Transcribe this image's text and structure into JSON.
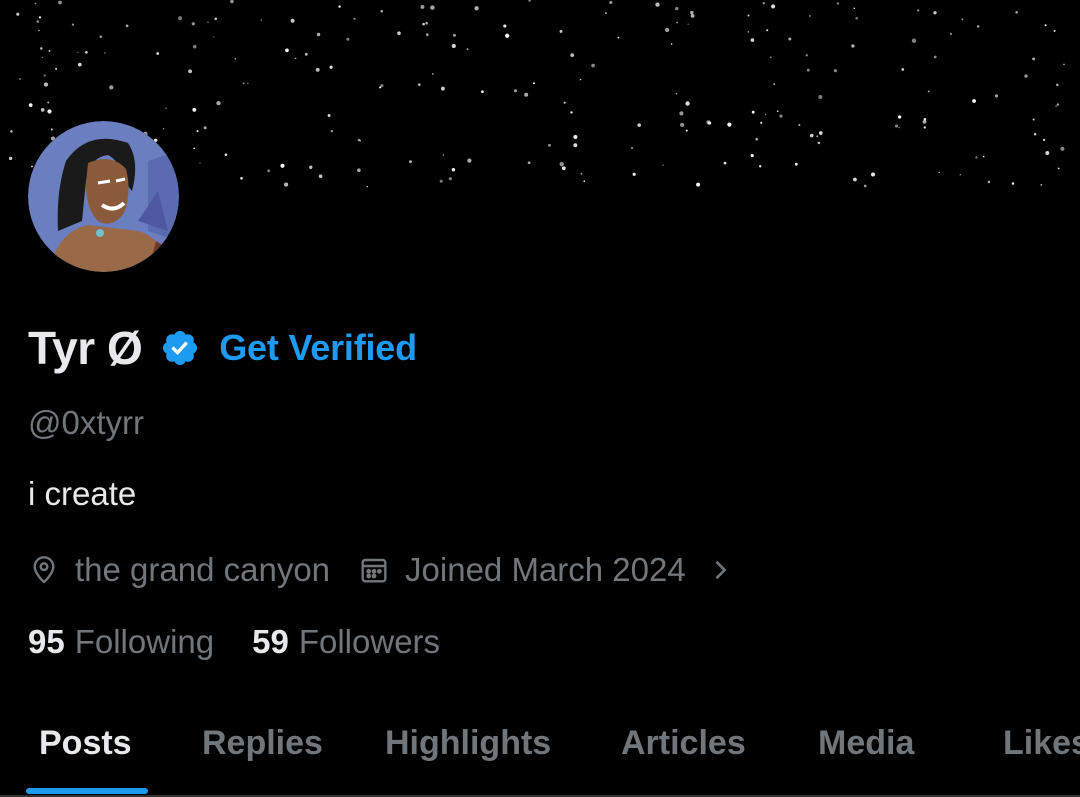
{
  "profile": {
    "display_name": "Tyr Ø",
    "get_verified_label": "Get Verified",
    "handle": "@0xtyrr",
    "bio": "i create",
    "location": "the grand canyon",
    "joined": "Joined March 2024",
    "following_count": "95",
    "following_label": "Following",
    "followers_count": "59",
    "followers_label": "Followers"
  },
  "tabs": [
    {
      "label": "Posts",
      "active": true
    },
    {
      "label": "Replies",
      "active": false
    },
    {
      "label": "Highlights",
      "active": false
    },
    {
      "label": "Articles",
      "active": false
    },
    {
      "label": "Media",
      "active": false
    },
    {
      "label": "Likes",
      "active": false
    }
  ],
  "icons": {
    "verified": "verified-badge-icon",
    "location": "location-pin-icon",
    "calendar": "calendar-icon",
    "chevron": "chevron-right-icon"
  },
  "colors": {
    "background": "#000000",
    "accent": "#1d9bf0",
    "primary_text": "#e7e9ea",
    "secondary_text": "#71767b"
  }
}
